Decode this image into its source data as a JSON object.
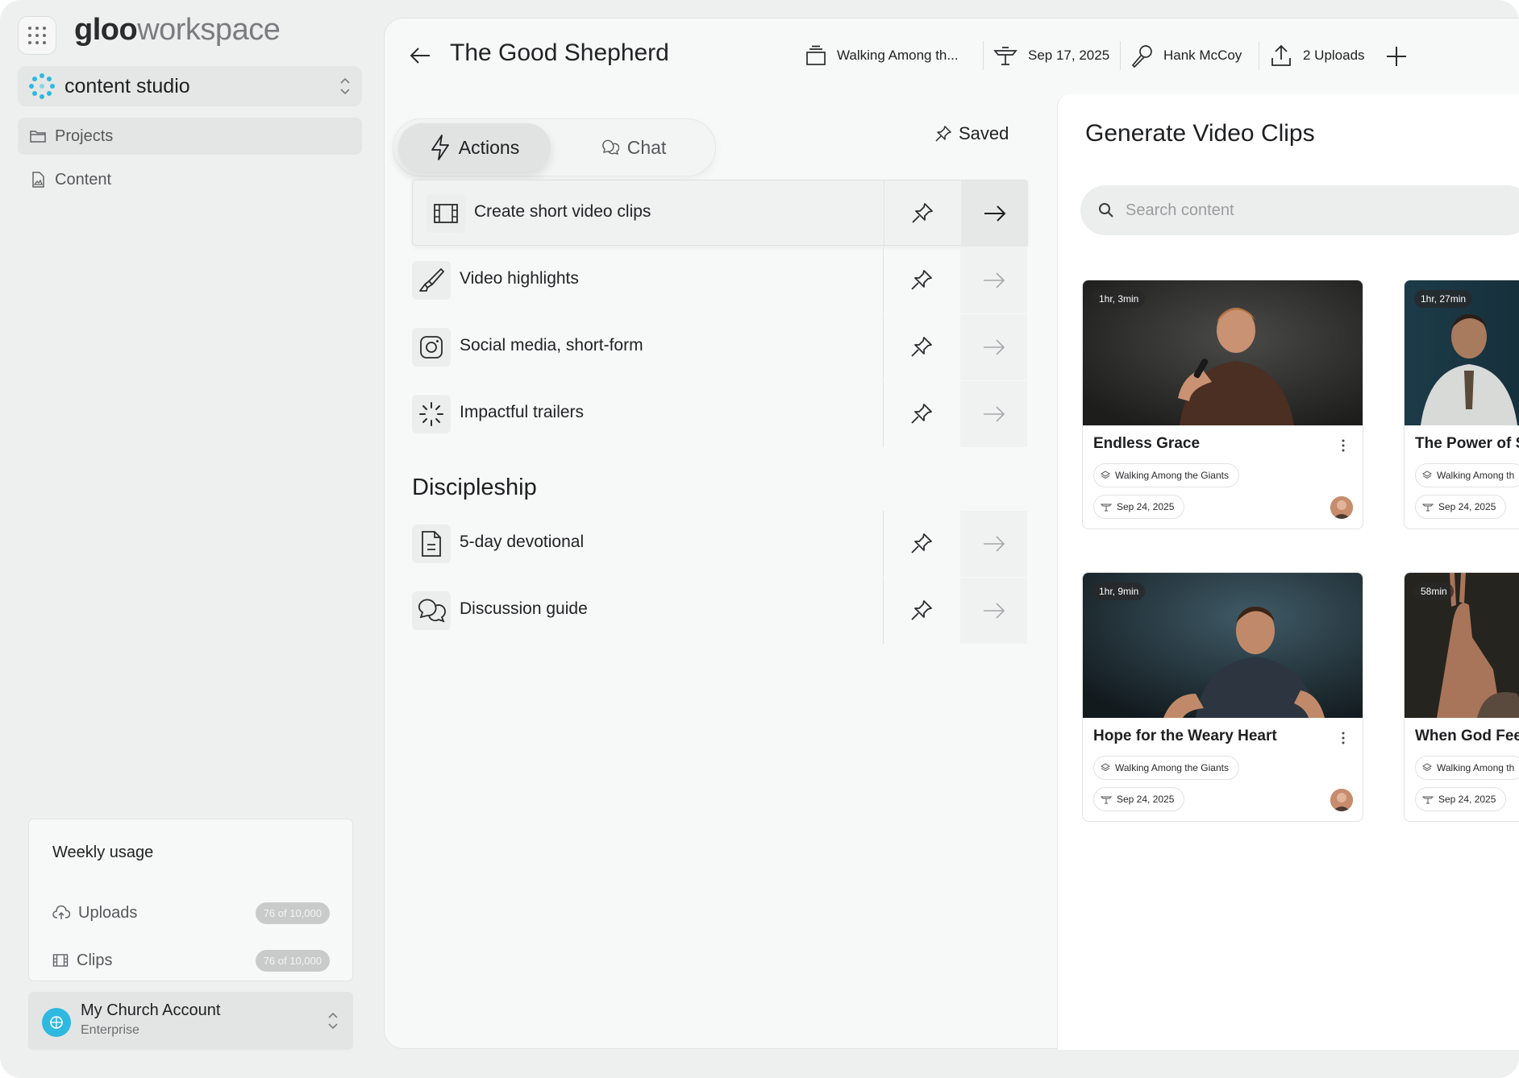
{
  "brand": {
    "logo_bold": "gloo",
    "logo_light": "workspace"
  },
  "studio": {
    "name": "content studio"
  },
  "nav": [
    {
      "label": "Projects",
      "icon": "folder-icon",
      "active": true
    },
    {
      "label": "Content",
      "icon": "document-image-icon",
      "active": false
    }
  ],
  "usage": {
    "title": "Weekly usage",
    "rows": [
      {
        "label": "Uploads",
        "value": "76 of 10,000",
        "icon": "cloud-upload-icon"
      },
      {
        "label": "Clips",
        "value": "76 of 10,000",
        "icon": "film-icon"
      }
    ]
  },
  "account": {
    "name": "My Church Account",
    "tier": "Enterprise"
  },
  "header": {
    "title": "The Good Shepherd",
    "series": "Walking Among th...",
    "date": "Sep 17, 2025",
    "speaker": "Hank McCoy",
    "uploads": "2 Uploads"
  },
  "tabs": {
    "actions": "Actions",
    "chat": "Chat",
    "active": "Actions"
  },
  "saved_label": "Saved",
  "actions": [
    {
      "label": "Create short video clips",
      "icon": "film-icon",
      "highlighted": true
    },
    {
      "label": "Video highlights",
      "icon": "highlighter-icon",
      "highlighted": false
    },
    {
      "label": "Social media, short-form",
      "icon": "instagram-icon",
      "highlighted": false
    },
    {
      "label": "Impactful trailers",
      "icon": "loader-icon",
      "highlighted": false
    }
  ],
  "discipleship": {
    "title": "Discipleship",
    "items": [
      {
        "label": "5-day devotional",
        "icon": "document-icon"
      },
      {
        "label": "Discussion guide",
        "icon": "chat-bubbles-icon"
      }
    ]
  },
  "generate": {
    "title": "Generate Video Clips",
    "search_placeholder": "Search content",
    "cards": [
      {
        "duration": "1hr, 3min",
        "title": "Endless Grace",
        "series": "Walking Among the Giants",
        "date": "Sep 24, 2025"
      },
      {
        "duration": "1hr, 27min",
        "title": "The Power of S",
        "series": "Walking Among th",
        "date": "Sep 24, 2025"
      },
      {
        "duration": "1hr, 9min",
        "title": "Hope for the Weary Heart",
        "series": "Walking Among the Giants",
        "date": "Sep 24, 2025"
      },
      {
        "duration": "58min",
        "title": "When God Fee",
        "series": "Walking Among th",
        "date": "Sep 24, 2025"
      }
    ]
  },
  "colors": {
    "accent": "#2fb8e0",
    "frame": "#eef0ef",
    "panel": "#f7f8f8"
  }
}
